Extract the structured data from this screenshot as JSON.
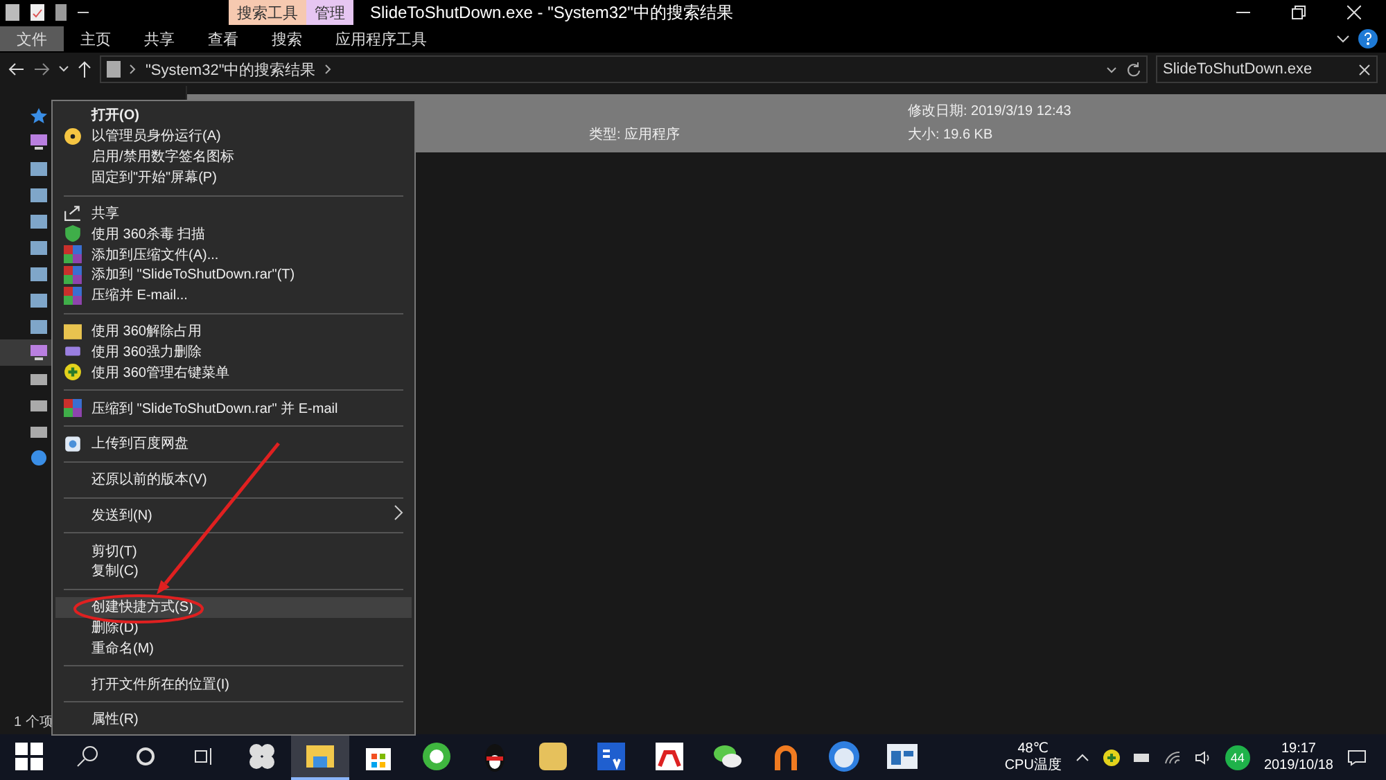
{
  "window": {
    "title": "SlideToShutDown.exe - \"System32\"中的搜索结果",
    "context_tabs": [
      {
        "label": "搜索工具",
        "color": "#f6c9b0"
      },
      {
        "label": "管理",
        "color": "#e6c6f2"
      }
    ]
  },
  "ribbon_tabs": [
    {
      "label": "文件",
      "selected": true
    },
    {
      "label": "主页",
      "selected": false
    },
    {
      "label": "共享",
      "selected": false
    },
    {
      "label": "查看",
      "selected": false
    },
    {
      "label": "搜索",
      "selected": false
    },
    {
      "label": "应用程序工具",
      "selected": false
    }
  ],
  "address": {
    "path": "\"System32\"中的搜索结果",
    "search_value": "SlideToShutDown.exe"
  },
  "sidebar": {
    "items": [
      {
        "kind": "star",
        "selected": false
      },
      {
        "kind": "pc",
        "selected": false
      },
      {
        "kind": "folder",
        "selected": false
      },
      {
        "kind": "folder",
        "selected": false
      },
      {
        "kind": "folder",
        "selected": false
      },
      {
        "kind": "folder",
        "selected": false
      },
      {
        "kind": "folder",
        "selected": false
      },
      {
        "kind": "folder",
        "selected": false
      },
      {
        "kind": "folder",
        "selected": false
      },
      {
        "kind": "pc",
        "selected": true
      },
      {
        "kind": "drive",
        "selected": false
      },
      {
        "kind": "drive",
        "selected": false
      },
      {
        "kind": "drive",
        "selected": false
      },
      {
        "kind": "globe",
        "selected": false
      }
    ]
  },
  "file": {
    "type": "类型: 应用程序",
    "modified": "修改日期: 2019/3/19 12:43",
    "size": "大小: 19.6 KB"
  },
  "status_bar": {
    "count": "1 个项"
  },
  "menu": {
    "items": [
      {
        "kind": "plain",
        "label": "打开(O)",
        "bold": true,
        "selected": false
      },
      {
        "kind": "admin",
        "label": "以管理员身份运行(A)",
        "bold": false,
        "selected": false
      },
      {
        "kind": "plain",
        "label": "启用/禁用数字签名图标",
        "bold": false,
        "selected": false
      },
      {
        "kind": "plain",
        "label": "固定到\"开始\"屏幕(P)",
        "bold": false,
        "selected": false
      },
      {
        "kind": "separator"
      },
      {
        "kind": "share",
        "label": "共享",
        "bold": false,
        "selected": false
      },
      {
        "kind": "shield",
        "label": "使用 360杀毒 扫描",
        "bold": false,
        "selected": false
      },
      {
        "kind": "archive",
        "label": "添加到压缩文件(A)...",
        "bold": false,
        "selected": false
      },
      {
        "kind": "archive",
        "label": "添加到 \"SlideToShutDown.rar\"(T)",
        "bold": false,
        "selected": false
      },
      {
        "kind": "archive",
        "label": "压缩并 E-mail...",
        "bold": false,
        "selected": false
      },
      {
        "kind": "separator"
      },
      {
        "kind": "unlock",
        "label": "使用 360解除占用",
        "bold": false,
        "selected": false
      },
      {
        "kind": "shredder",
        "label": "使用 360强力删除",
        "bold": false,
        "selected": false
      },
      {
        "kind": "plus",
        "label": "使用 360管理右键菜单",
        "bold": false,
        "selected": false
      },
      {
        "kind": "separator"
      },
      {
        "kind": "archive",
        "label": "压缩到 \"SlideToShutDown.rar\" 并 E-mail",
        "bold": false,
        "selected": false
      },
      {
        "kind": "separator"
      },
      {
        "kind": "cloud",
        "label": "上传到百度网盘",
        "bold": false,
        "selected": false
      },
      {
        "kind": "separator"
      },
      {
        "kind": "plain",
        "label": "还原以前的版本(V)",
        "bold": false,
        "selected": false
      },
      {
        "kind": "separator"
      },
      {
        "kind": "plain",
        "label": "发送到(N)",
        "bold": false,
        "selected": false,
        "submenu": true
      },
      {
        "kind": "separator"
      },
      {
        "kind": "plain",
        "label": "剪切(T)",
        "bold": false,
        "selected": false
      },
      {
        "kind": "plain",
        "label": "复制(C)",
        "bold": false,
        "selected": false
      },
      {
        "kind": "separator"
      },
      {
        "kind": "plain",
        "label": "创建快捷方式(S)",
        "bold": false,
        "selected": true
      },
      {
        "kind": "plain",
        "label": "删除(D)",
        "bold": false,
        "selected": false
      },
      {
        "kind": "plain",
        "label": "重命名(M)",
        "bold": false,
        "selected": false
      },
      {
        "kind": "separator"
      },
      {
        "kind": "plain",
        "label": "打开文件所在的位置(I)",
        "bold": false,
        "selected": false
      },
      {
        "kind": "separator"
      },
      {
        "kind": "plain",
        "label": "属性(R)",
        "bold": false,
        "selected": false
      }
    ]
  },
  "taskbar": {
    "apps": [
      {
        "kind": "fan",
        "selected": false
      },
      {
        "kind": "explorer",
        "selected": true
      },
      {
        "kind": "store",
        "selected": false
      },
      {
        "kind": "browser",
        "selected": false
      },
      {
        "kind": "penguin",
        "selected": false
      },
      {
        "kind": "gold",
        "selected": false
      },
      {
        "kind": "tools",
        "selected": false
      },
      {
        "kind": "red",
        "selected": false
      },
      {
        "kind": "chat",
        "selected": false
      },
      {
        "kind": "keyhole",
        "selected": false
      },
      {
        "kind": "face",
        "selected": false
      },
      {
        "kind": "window",
        "selected": false
      }
    ],
    "cpu_temp": "48℃",
    "cpu_label": "CPU温度",
    "badge": "44",
    "time": "19:17",
    "date": "2019/10/18"
  }
}
